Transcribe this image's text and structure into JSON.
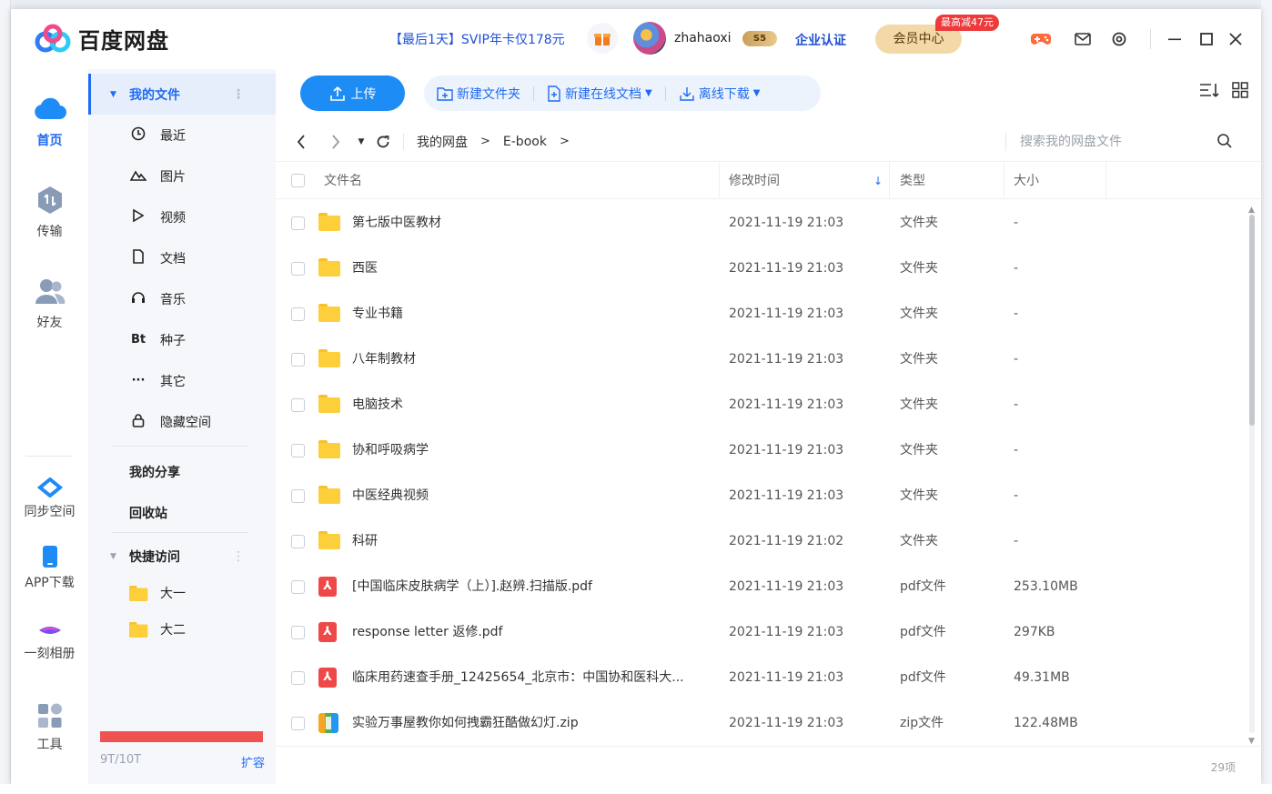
{
  "app": {
    "title": "百度网盘",
    "promo": "【最后1天】SVIP年卡仅178元",
    "username": "zhahaoxi",
    "vip_badge": "5",
    "enterprise": "企业认证",
    "member_center": "会员中心",
    "member_tag": "最高减47元",
    "accent_color": "#1f6bf2"
  },
  "leftnav": {
    "items": [
      {
        "label": "首页",
        "icon": "cloud-icon"
      },
      {
        "label": "传输",
        "icon": "transfer-icon"
      },
      {
        "label": "好友",
        "icon": "friends-icon"
      },
      {
        "label": "同步空间",
        "icon": "sync-icon"
      },
      {
        "label": "APP下载",
        "icon": "phone-icon"
      },
      {
        "label": "一刻相册",
        "icon": "album-icon"
      },
      {
        "label": "工具",
        "icon": "tools-icon"
      }
    ]
  },
  "sidebar": {
    "my_files": "我的文件",
    "items": [
      {
        "label": "最近",
        "icon": "clock-icon"
      },
      {
        "label": "图片",
        "icon": "image-icon"
      },
      {
        "label": "视频",
        "icon": "play-icon"
      },
      {
        "label": "文档",
        "icon": "document-icon"
      },
      {
        "label": "音乐",
        "icon": "headphones-icon"
      },
      {
        "label": "种子",
        "icon": "bt-icon",
        "glyph": "Bt"
      },
      {
        "label": "其它",
        "icon": "more-icon"
      },
      {
        "label": "隐藏空间",
        "icon": "lock-icon"
      }
    ],
    "my_share": "我的分享",
    "recycle": "回收站",
    "quick_access": "快捷访问",
    "quick_items": [
      {
        "label": "大一"
      },
      {
        "label": "大二"
      }
    ],
    "quota": "9T/10T",
    "quota_fraction": 0.9,
    "expand": "扩容"
  },
  "toolbar": {
    "upload": "上传",
    "new_folder": "新建文件夹",
    "new_online_doc": "新建在线文档",
    "offline_download": "离线下载"
  },
  "path": {
    "crumbs": [
      "我的网盘",
      "E-book"
    ],
    "search_placeholder": "搜索我的网盘文件"
  },
  "table": {
    "headers": {
      "name": "文件名",
      "modified": "修改时间",
      "type": "类型",
      "size": "大小"
    },
    "rows": [
      {
        "name": "第七版中医教材",
        "time": "2021-11-19 21:03",
        "type": "文件夹",
        "size": "-",
        "kind": "folder"
      },
      {
        "name": "西医",
        "time": "2021-11-19 21:03",
        "type": "文件夹",
        "size": "-",
        "kind": "folder"
      },
      {
        "name": "专业书籍",
        "time": "2021-11-19 21:03",
        "type": "文件夹",
        "size": "-",
        "kind": "folder"
      },
      {
        "name": "八年制教材",
        "time": "2021-11-19 21:03",
        "type": "文件夹",
        "size": "-",
        "kind": "folder"
      },
      {
        "name": "电脑技术",
        "time": "2021-11-19 21:03",
        "type": "文件夹",
        "size": "-",
        "kind": "folder"
      },
      {
        "name": "协和呼吸病学",
        "time": "2021-11-19 21:03",
        "type": "文件夹",
        "size": "-",
        "kind": "folder"
      },
      {
        "name": "中医经典视频",
        "time": "2021-11-19 21:03",
        "type": "文件夹",
        "size": "-",
        "kind": "folder"
      },
      {
        "name": "科研",
        "time": "2021-11-19 21:02",
        "type": "文件夹",
        "size": "-",
        "kind": "folder"
      },
      {
        "name": "[中国临床皮肤病学（上）].赵辨.扫描版.pdf",
        "time": "2021-11-19 21:03",
        "type": "pdf文件",
        "size": "253.10MB",
        "kind": "pdf"
      },
      {
        "name": "response letter 返修.pdf",
        "time": "2021-11-19 21:03",
        "type": "pdf文件",
        "size": "297KB",
        "kind": "pdf"
      },
      {
        "name": "临床用药速查手册_12425654_北京市：中国协和医科大...",
        "time": "2021-11-19 21:03",
        "type": "pdf文件",
        "size": "49.31MB",
        "kind": "pdf"
      },
      {
        "name": "实验万事屋教你如何拽霸狂酷做幻灯.zip",
        "time": "2021-11-19 21:03",
        "type": "zip文件",
        "size": "122.48MB",
        "kind": "zip"
      }
    ]
  },
  "footer": {
    "count": "29项"
  }
}
